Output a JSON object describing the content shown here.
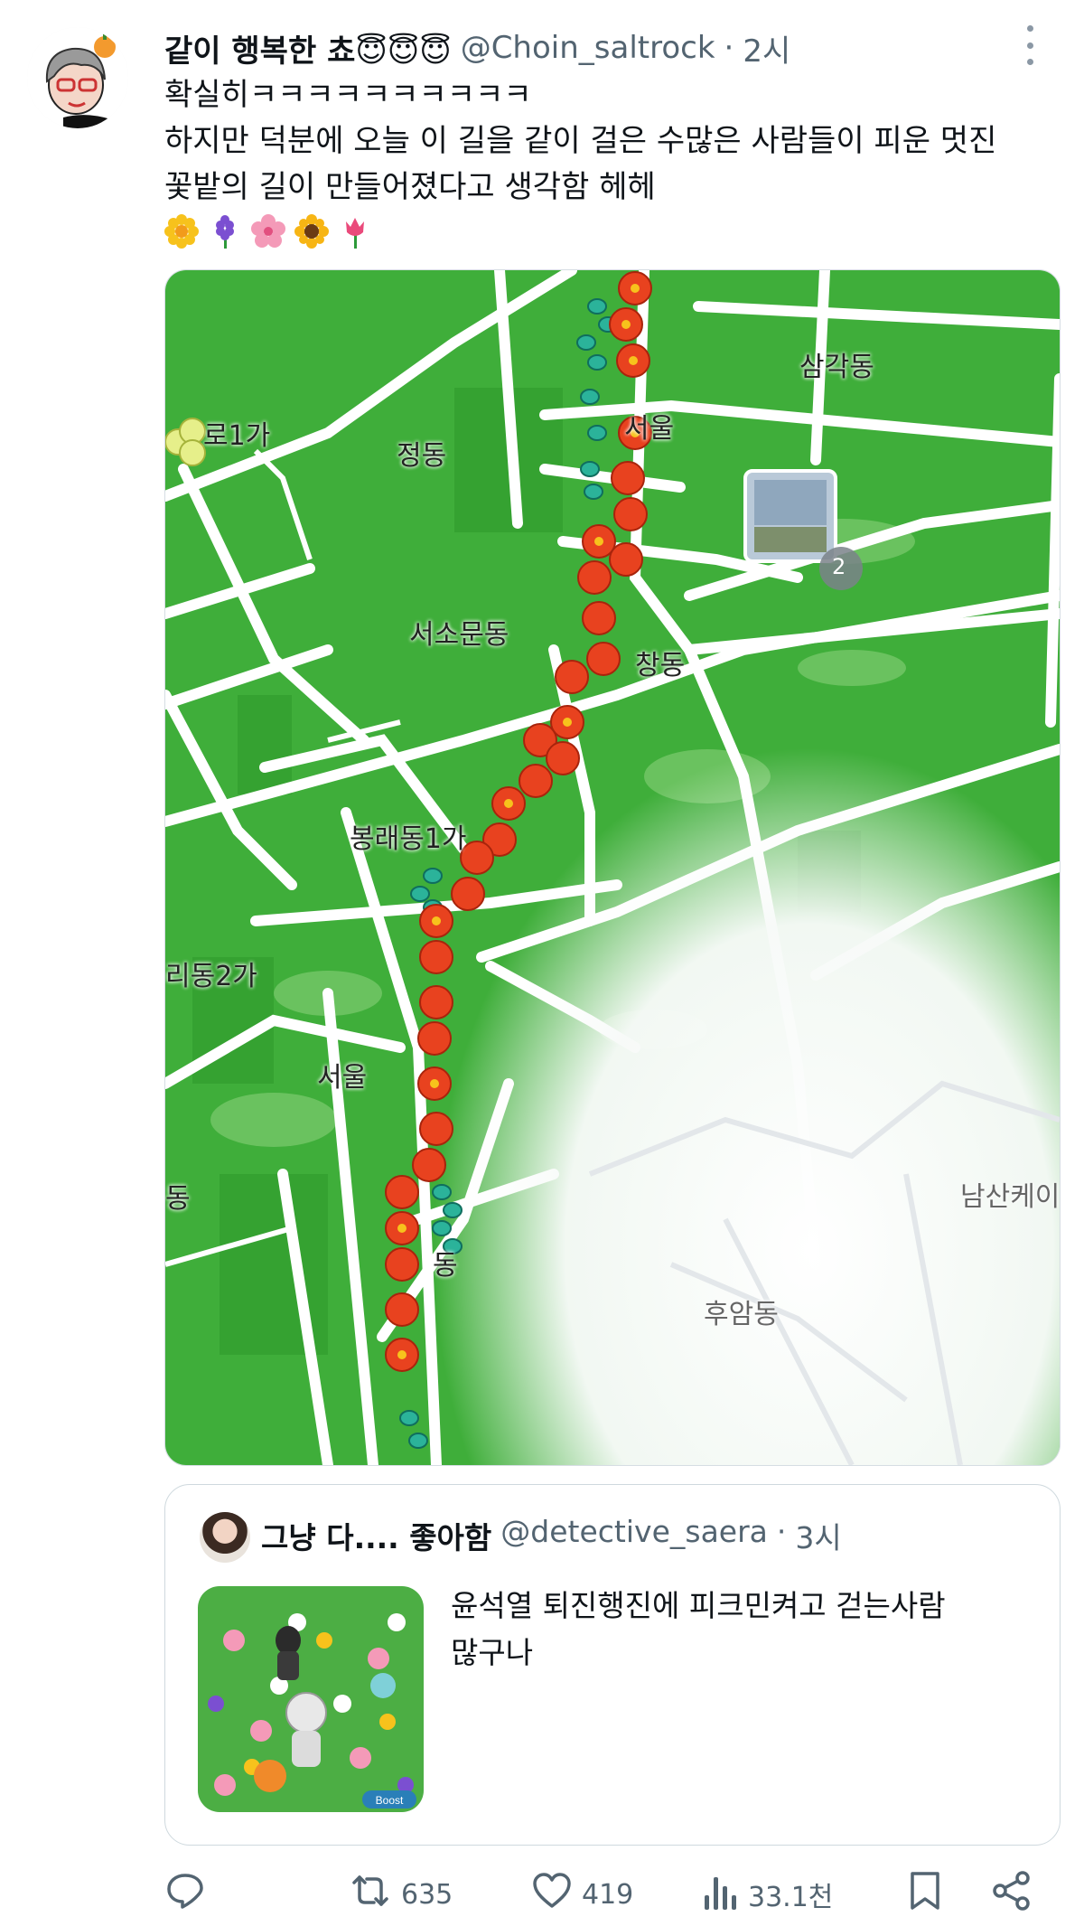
{
  "tweet": {
    "display_name": "같이 행복한 쵸😇😇😇",
    "handle": "@Choin_saltrock",
    "separator": "·",
    "time": "2시",
    "text_lines": [
      "확실히ㅋㅋㅋㅋㅋㅋㅋㅋㅋㅋ",
      "하지만 덕분에 오늘 이 길을 같이 걸은 수많은 사람들이 피운 멋진",
      "꽃밭의 길이 만들어졌다고 생각함 헤헤"
    ],
    "emojis": [
      "sunflower-blossom-icon",
      "hyacinth-icon",
      "cherry-blossom-icon",
      "sunflower-icon",
      "tulip-icon"
    ]
  },
  "map": {
    "labels": [
      "삼각동",
      "로1가",
      "정동",
      "서울",
      "서소문동",
      "창동",
      "봉래동1가",
      "리동2가",
      "서울",
      "남산케이",
      "동",
      "동",
      "후암동"
    ],
    "cluster_badge": "2",
    "colors": {
      "grass": "#3fae3a",
      "road": "#ffffff",
      "flower": "#e8421f",
      "footprint": "#2bb39a"
    }
  },
  "quote": {
    "display_name": "그냥 다.... 좋아함",
    "handle": "@detective_saera",
    "separator": "·",
    "time": "3시",
    "text_lines": [
      "윤석열 퇴진행진에 피크민켜고 걷는사람",
      "많구나"
    ],
    "thumb_badge": "Boost"
  },
  "actions": {
    "reply_count": "",
    "retweet_count": "635",
    "like_count": "419",
    "views_count": "33.1천"
  }
}
